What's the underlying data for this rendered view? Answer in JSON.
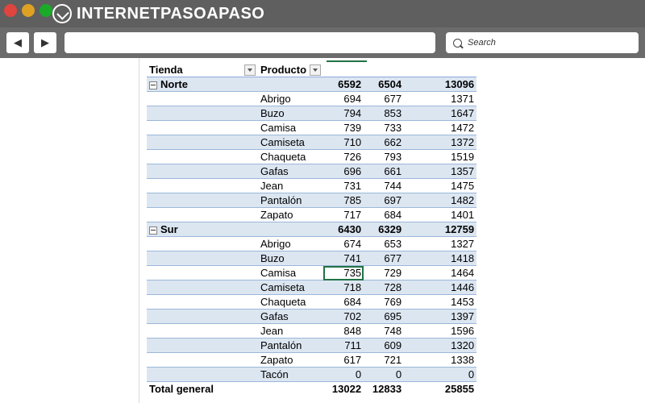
{
  "site": {
    "brand_part1": "INTERNET",
    "brand_part2": "PASO",
    "brand_part3": "A",
    "brand_part4": "PASO"
  },
  "browser": {
    "search_placeholder": "Search"
  },
  "pivot": {
    "header": {
      "col0": "Tienda",
      "col1": "Producto"
    },
    "groups": [
      {
        "name": "Norte",
        "totals": [
          "6592",
          "6504",
          "13096"
        ],
        "rows": [
          {
            "product": "Abrigo",
            "values": [
              "694",
              "677",
              "1371"
            ]
          },
          {
            "product": "Buzo",
            "values": [
              "794",
              "853",
              "1647"
            ]
          },
          {
            "product": "Camisa",
            "values": [
              "739",
              "733",
              "1472"
            ]
          },
          {
            "product": "Camiseta",
            "values": [
              "710",
              "662",
              "1372"
            ]
          },
          {
            "product": "Chaqueta",
            "values": [
              "726",
              "793",
              "1519"
            ]
          },
          {
            "product": "Gafas",
            "values": [
              "696",
              "661",
              "1357"
            ]
          },
          {
            "product": "Jean",
            "values": [
              "731",
              "744",
              "1475"
            ]
          },
          {
            "product": "Pantalón",
            "values": [
              "785",
              "697",
              "1482"
            ]
          },
          {
            "product": "Zapato",
            "values": [
              "717",
              "684",
              "1401"
            ]
          }
        ]
      },
      {
        "name": "Sur",
        "totals": [
          "6430",
          "6329",
          "12759"
        ],
        "rows": [
          {
            "product": "Abrigo",
            "values": [
              "674",
              "653",
              "1327"
            ]
          },
          {
            "product": "Buzo",
            "values": [
              "741",
              "677",
              "1418"
            ]
          },
          {
            "product": "Camisa",
            "values": [
              "735",
              "729",
              "1464"
            ]
          },
          {
            "product": "Camiseta",
            "values": [
              "718",
              "728",
              "1446"
            ]
          },
          {
            "product": "Chaqueta",
            "values": [
              "684",
              "769",
              "1453"
            ]
          },
          {
            "product": "Gafas",
            "values": [
              "702",
              "695",
              "1397"
            ]
          },
          {
            "product": "Jean",
            "values": [
              "848",
              "748",
              "1596"
            ]
          },
          {
            "product": "Pantalón",
            "values": [
              "711",
              "609",
              "1320"
            ]
          },
          {
            "product": "Zapato",
            "values": [
              "617",
              "721",
              "1338"
            ]
          },
          {
            "product": "Tacón",
            "values": [
              "0",
              "0",
              "0"
            ]
          }
        ]
      }
    ],
    "total": {
      "label": "Total general",
      "values": [
        "13022",
        "12833",
        "25855"
      ]
    }
  }
}
